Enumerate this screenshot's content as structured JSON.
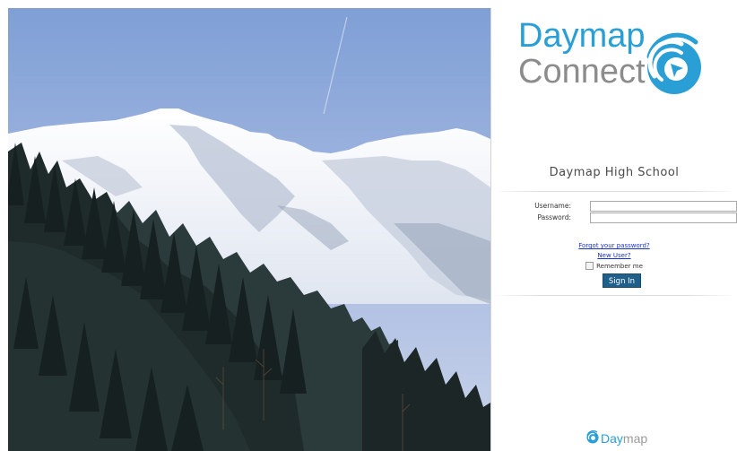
{
  "logo": {
    "line1": "Daymap",
    "line2": "Connect",
    "mark_icon": "daymap-swirl-cursor-icon",
    "primary_color": "#2a9fd6",
    "secondary_color": "#8c8c8c"
  },
  "school": {
    "name": "Daymap High School"
  },
  "form": {
    "username_label": "Username:",
    "username_value": "",
    "password_label": "Password:",
    "password_value": ""
  },
  "links": {
    "forgot_password": "Forgot your password?",
    "new_user": "New User?"
  },
  "remember": {
    "label": "Remember me",
    "checked": false
  },
  "actions": {
    "sign_in_label": "Sign In",
    "button_color": "#1f5f8a"
  },
  "footer": {
    "brand_part1": "Day",
    "brand_part2": "map",
    "icon": "daymap-swirl-icon"
  },
  "hero": {
    "description_icon": "mountain-landscape-image"
  }
}
